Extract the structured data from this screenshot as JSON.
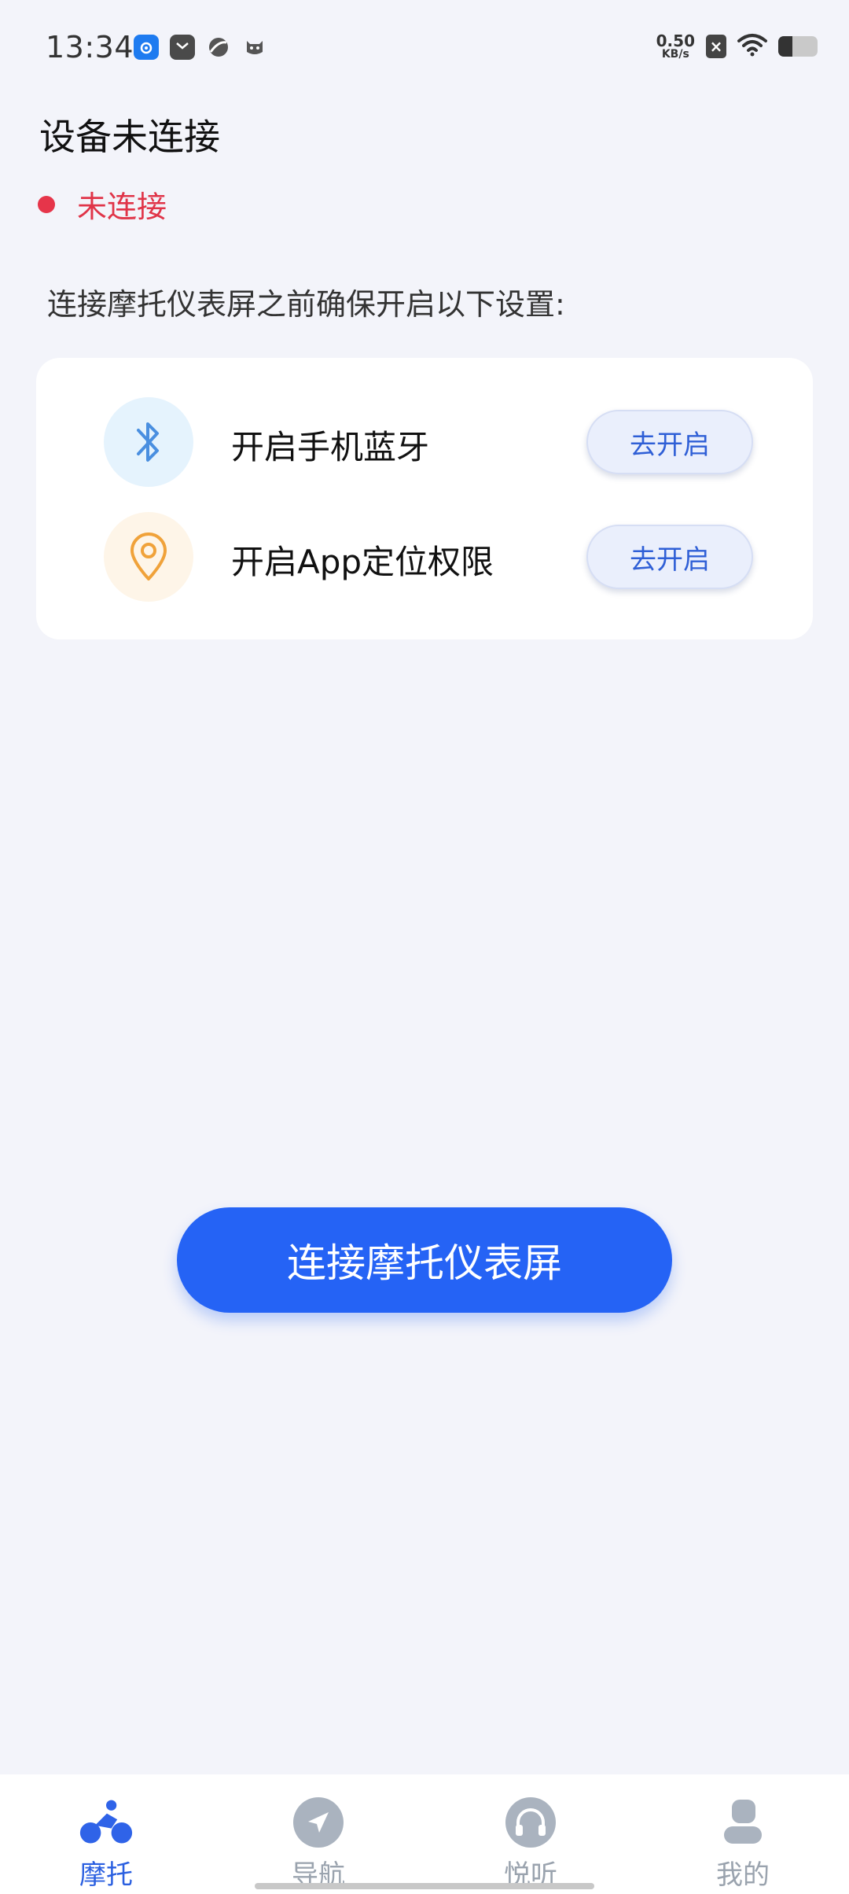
{
  "status_bar": {
    "time": "13:34",
    "net_speed_value": "0.50",
    "net_speed_unit": "KB/s"
  },
  "header": {
    "title": "设备未连接",
    "status": "未连接",
    "status_color": "#e6354a"
  },
  "intro_text": "连接摩托仪表屏之前确保开启以下设置:",
  "settings": [
    {
      "icon": "bluetooth-icon",
      "label": "开启手机蓝牙",
      "button": "去开启"
    },
    {
      "icon": "location-pin-icon",
      "label": "开启App定位权限",
      "button": "去开启"
    }
  ],
  "connect_button": "连接摩托仪表屏",
  "bottom_nav": {
    "tabs": [
      {
        "icon": "motorcycle-icon",
        "label": "摩托",
        "active": true
      },
      {
        "icon": "navigation-icon",
        "label": "导航",
        "active": false
      },
      {
        "icon": "headphones-icon",
        "label": "悦听",
        "active": false
      },
      {
        "icon": "profile-icon",
        "label": "我的",
        "active": false
      }
    ]
  },
  "colors": {
    "accent": "#2563f5",
    "background": "#f3f4fa",
    "error": "#e03448"
  }
}
